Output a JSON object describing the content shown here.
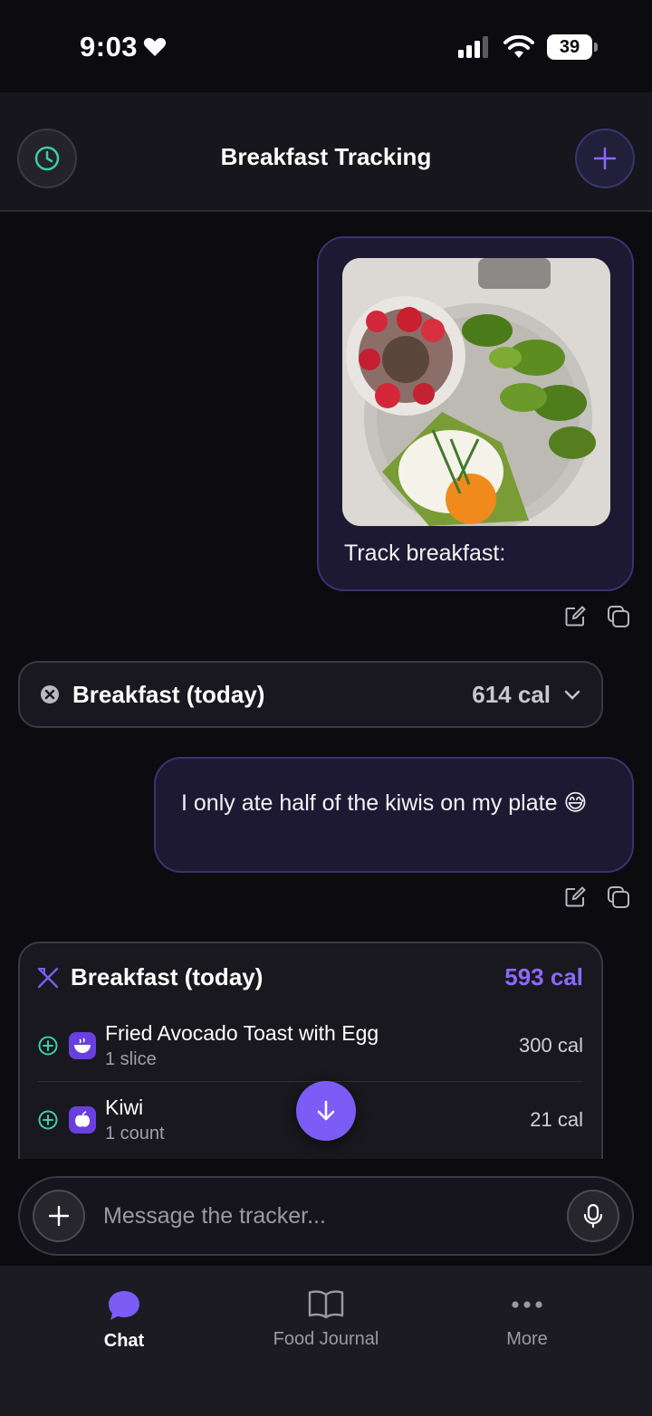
{
  "status_bar": {
    "time": "9:03",
    "battery": "39"
  },
  "header": {
    "title": "Breakfast Tracking",
    "history_icon": "clock-icon",
    "new_icon": "plus-icon"
  },
  "messages": {
    "photo_message": {
      "caption": "Track breakfast:"
    },
    "summary_pill": {
      "title": "Breakfast (today)",
      "calories": "614 cal"
    },
    "text_message": {
      "text": "I only ate half of the kiwis on my plate 😅"
    },
    "meal_card": {
      "title": "Breakfast (today)",
      "calories": "593 cal",
      "items": [
        {
          "name": "Fried Avocado Toast with Egg",
          "quantity": "1 slice",
          "calories": "300 cal"
        },
        {
          "name": "Kiwi",
          "quantity": "1 count",
          "calories": "21 cal"
        }
      ]
    }
  },
  "composer": {
    "placeholder": "Message the tracker..."
  },
  "tabs": [
    {
      "label": "Chat",
      "icon": "chat-bubble-icon",
      "active": true
    },
    {
      "label": "Food Journal",
      "icon": "book-icon",
      "active": false
    },
    {
      "label": "More",
      "icon": "more-dots-icon",
      "active": false
    }
  ],
  "colors": {
    "accent": "#7b5cf5",
    "accent_text": "#8d68ff",
    "teal": "#3ecfa0",
    "background": "#0b0b10"
  }
}
